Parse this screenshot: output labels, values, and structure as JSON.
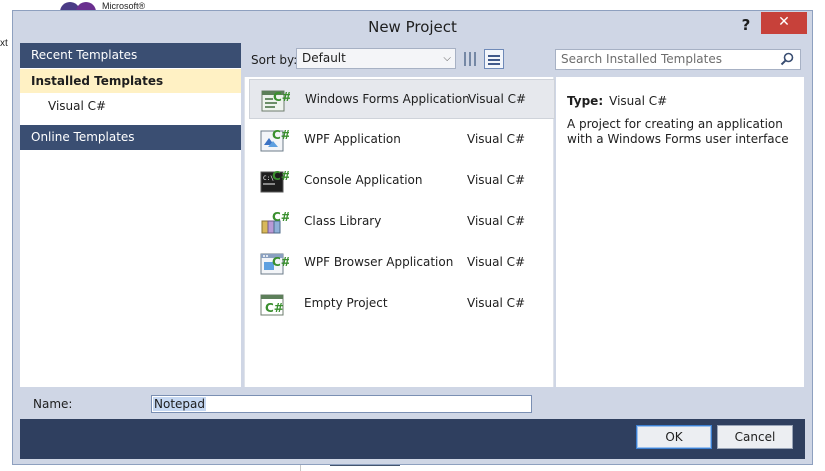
{
  "background_app": {
    "logo_text": "Microsoft®",
    "edge_text": "xt"
  },
  "dialog": {
    "title": "New Project",
    "help_glyph": "?",
    "close_glyph": "✕"
  },
  "left_pane": {
    "recent_templates": "Recent Templates",
    "installed_templates": "Installed Templates",
    "installed_child": "Visual C#",
    "online_templates": "Online Templates"
  },
  "toolbar": {
    "sort_label": "Sort by:",
    "sort_value": "Default",
    "search_placeholder": "Search Installed Templates"
  },
  "templates": [
    {
      "name": "Windows Forms Application",
      "lang": "Visual C#",
      "icon": "windows-forms-icon",
      "selected": true
    },
    {
      "name": "WPF Application",
      "lang": "Visual C#",
      "icon": "wpf-application-icon",
      "selected": false
    },
    {
      "name": "Console Application",
      "lang": "Visual C#",
      "icon": "console-application-icon",
      "selected": false
    },
    {
      "name": "Class Library",
      "lang": "Visual C#",
      "icon": "class-library-icon",
      "selected": false
    },
    {
      "name": "WPF Browser Application",
      "lang": "Visual C#",
      "icon": "wpf-browser-icon",
      "selected": false
    },
    {
      "name": "Empty Project",
      "lang": "Visual C#",
      "icon": "empty-project-icon",
      "selected": false
    }
  ],
  "details": {
    "type_label": "Type:",
    "type_value": "Visual C#",
    "description": "A project for creating an application with a Windows Forms user interface"
  },
  "name_row": {
    "label": "Name:",
    "value": "Notepad"
  },
  "footer": {
    "ok_label": "OK",
    "cancel_label": "Cancel"
  },
  "colors": {
    "header_blue": "#3a4e72",
    "selected_yellow": "#fff1c4",
    "close_red": "#c7413a",
    "csharp_green": "#3a8f2e",
    "footer_navy": "#2f3f5f"
  }
}
